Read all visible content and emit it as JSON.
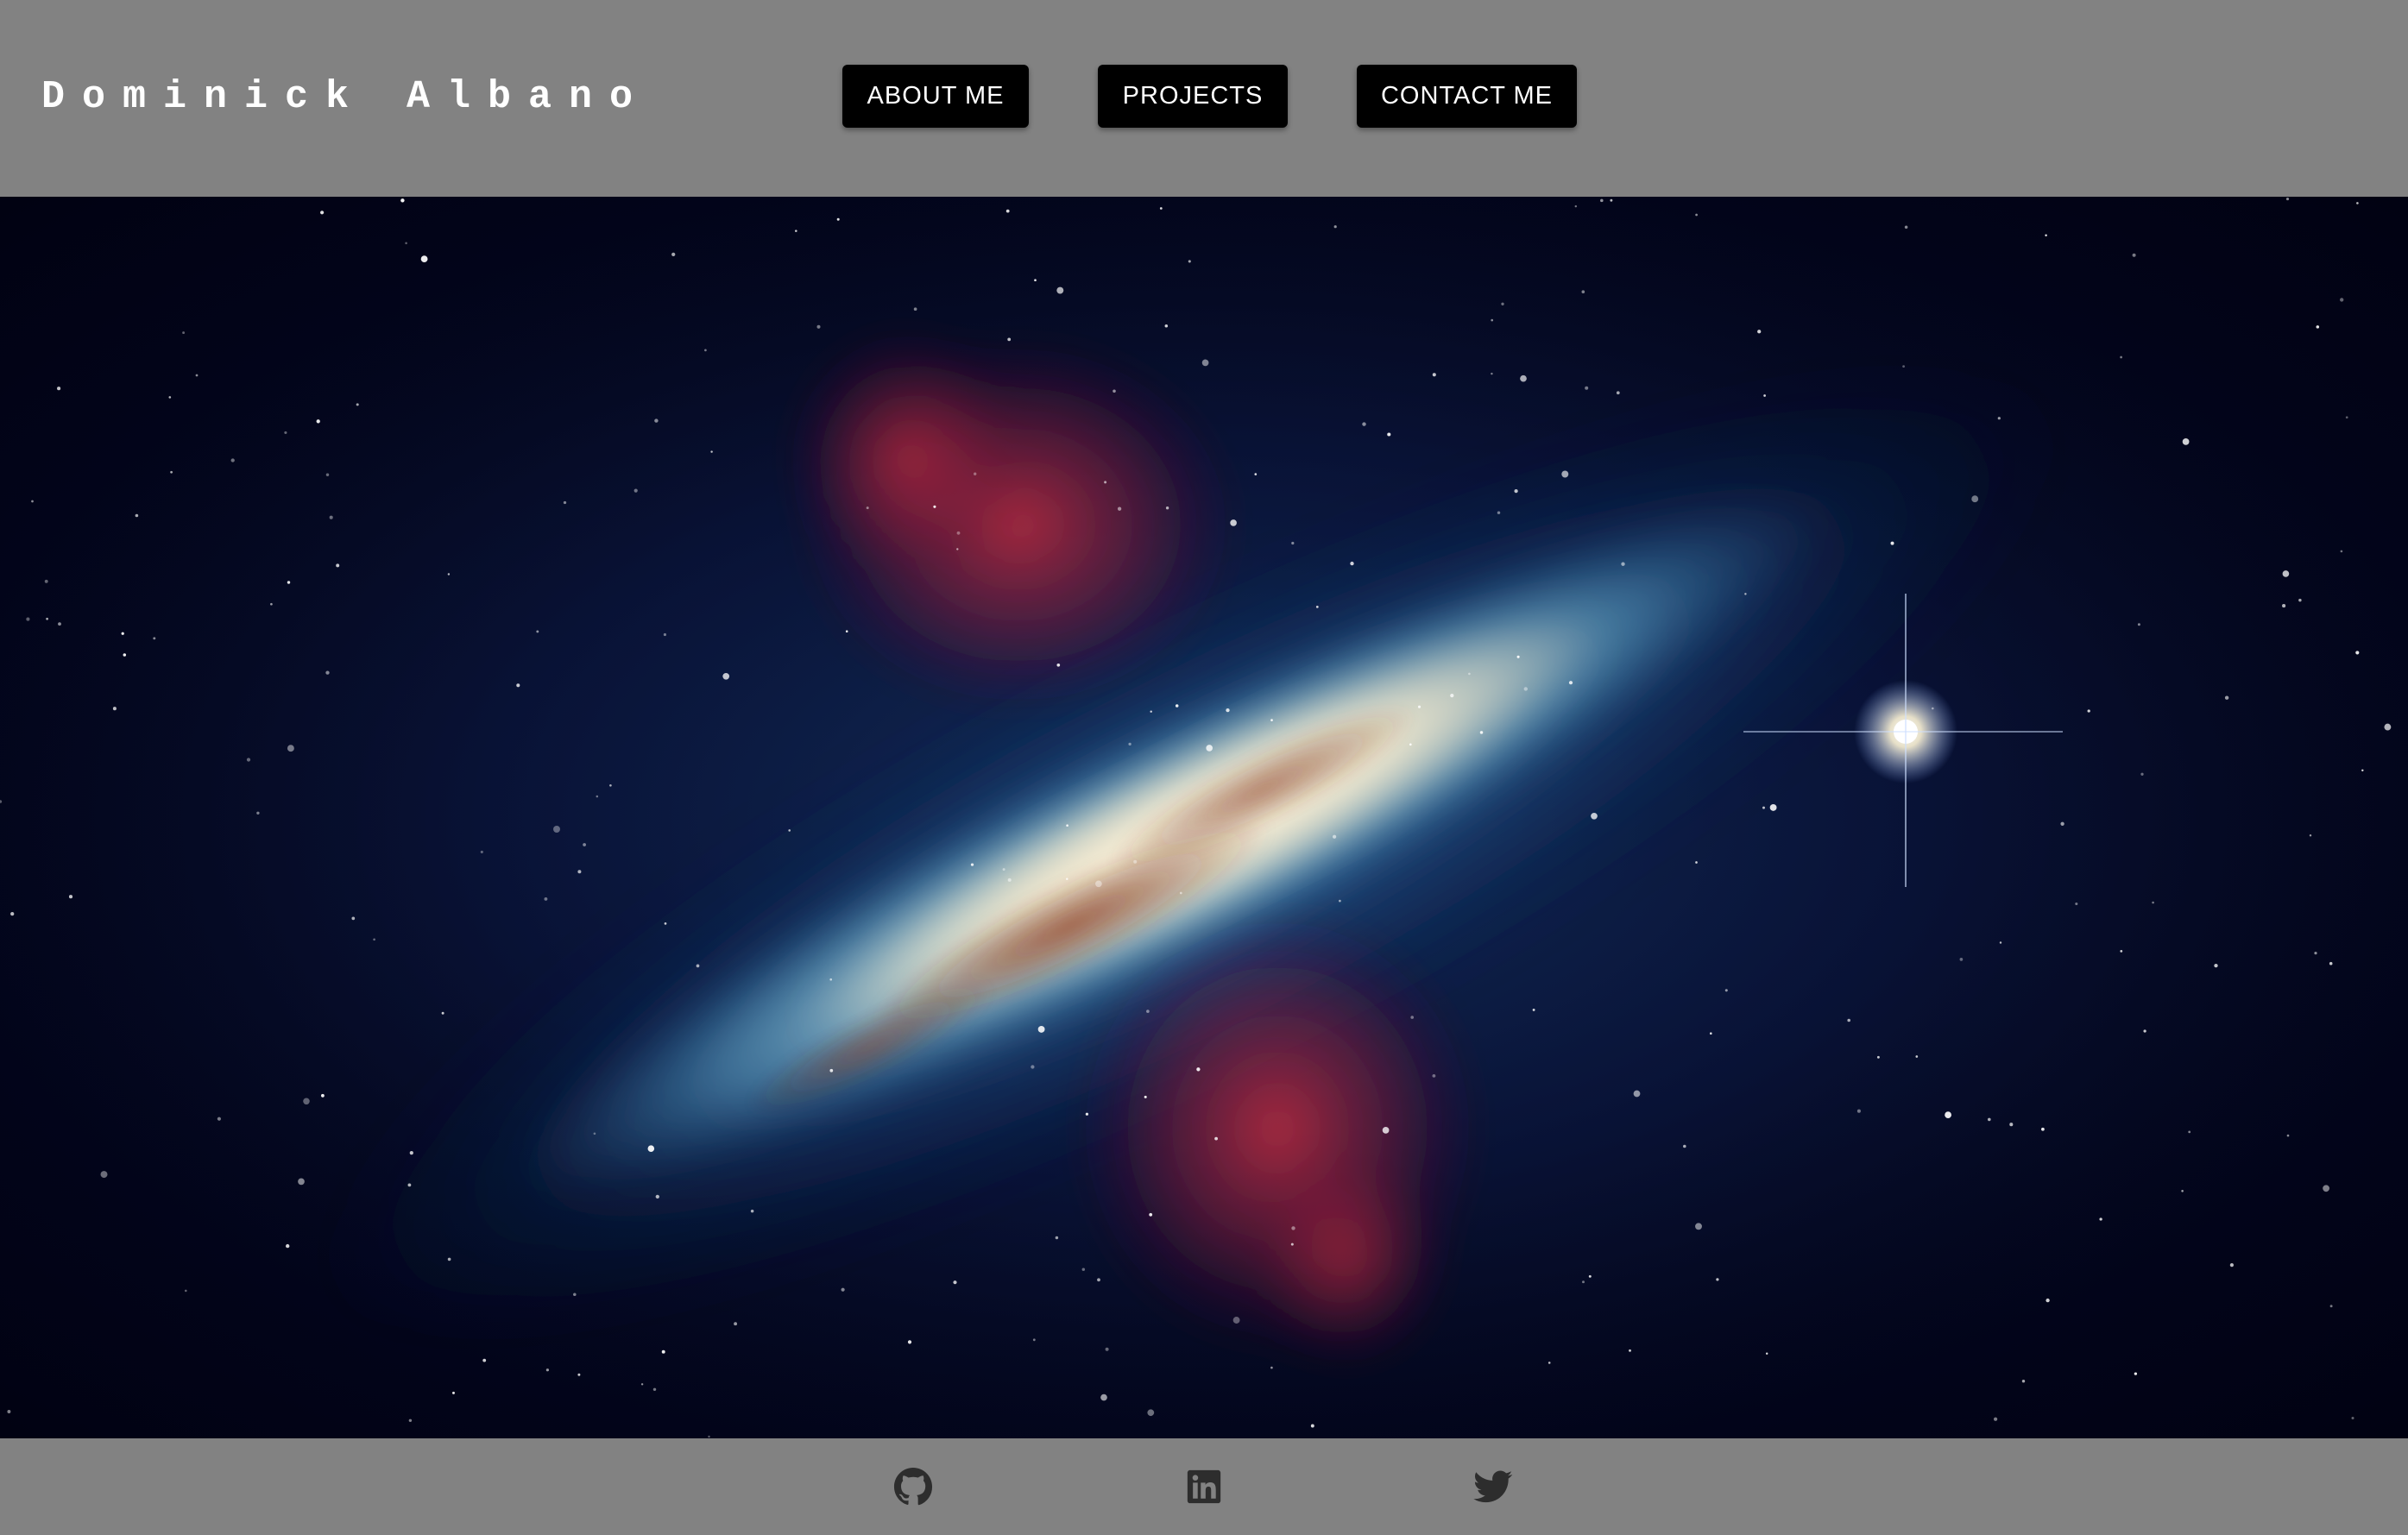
{
  "header": {
    "brand": "Dominick Albano",
    "nav": [
      {
        "label": "ABOUT ME"
      },
      {
        "label": "PROJECTS"
      },
      {
        "label": "CONTACT ME"
      }
    ]
  },
  "hero": {
    "image": "galaxy-nebula-photo"
  },
  "footer": {
    "social_icons": [
      "github-icon",
      "linkedin-icon",
      "twitter-icon"
    ]
  },
  "colors": {
    "header_bg": "#828282",
    "button_bg": "#000000",
    "button_text": "#ffffff",
    "icon_color": "#2d2d2d"
  }
}
